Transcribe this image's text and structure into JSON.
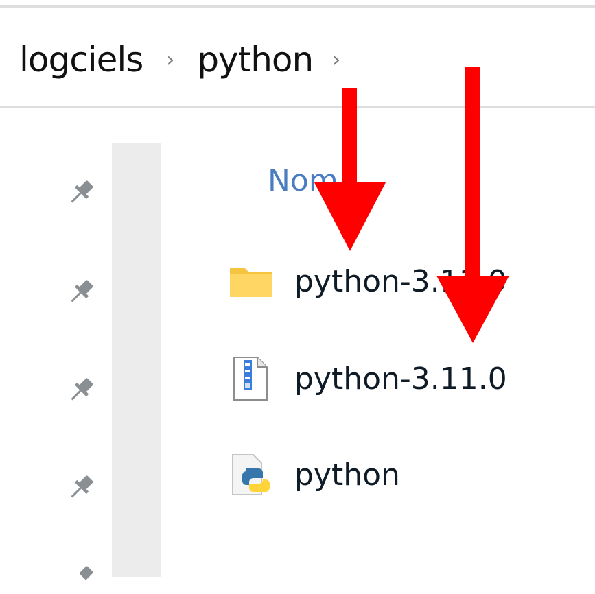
{
  "breadcrumb": {
    "items": [
      "logciels",
      "python"
    ],
    "separator": "›"
  },
  "column_header": "Nom",
  "files": [
    {
      "name": "python-3.11.0",
      "icon": "folder-icon"
    },
    {
      "name": "python-3.11.0",
      "icon": "zip-archive-icon"
    },
    {
      "name": "python",
      "icon": "python-file-icon"
    }
  ],
  "quick_access_pins": [
    "pin-icon",
    "pin-icon",
    "pin-icon",
    "pin-icon"
  ],
  "annotation": {
    "arrow_color": "#ff0000",
    "arrow_count": 2
  },
  "colors": {
    "header_text": "#4a7cc0",
    "folder": "#f5c542"
  }
}
